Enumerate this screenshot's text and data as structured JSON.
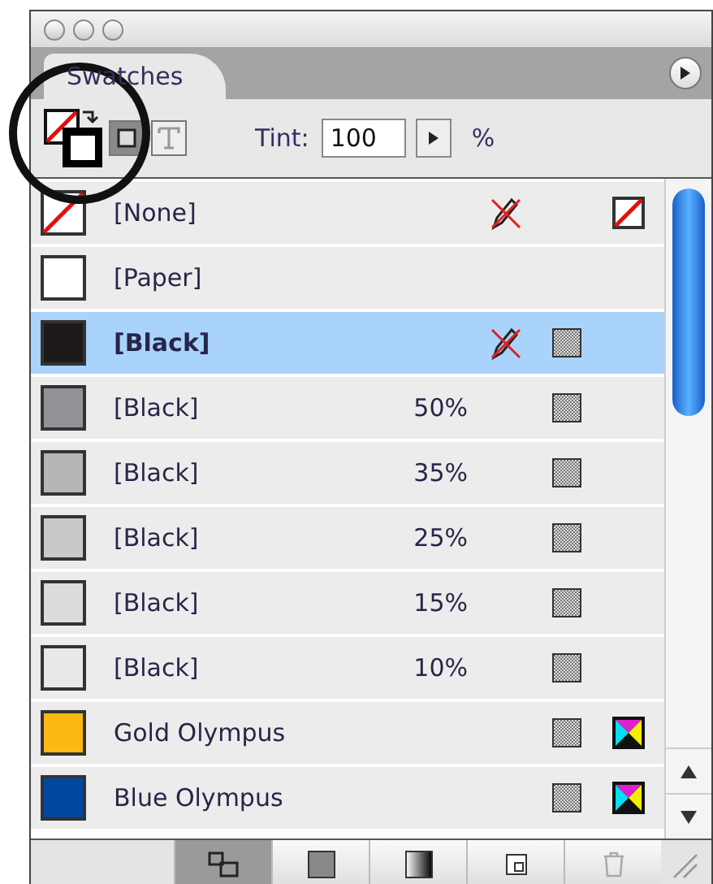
{
  "panel": {
    "tab": "Swatches"
  },
  "toolbar": {
    "modes": [
      {
        "kind": "container",
        "selected": true
      },
      {
        "kind": "text",
        "selected": false
      }
    ],
    "tint_label": "Tint:",
    "tint_value": "100",
    "percent": "%"
  },
  "swatches": [
    {
      "name": "[None]",
      "kind": "none",
      "locked": true,
      "process": false,
      "cmyk": false,
      "selected": false
    },
    {
      "name": "[Paper]",
      "kind": "solid",
      "color": "#ffffff",
      "locked": false,
      "process": false,
      "cmyk": false,
      "selected": false
    },
    {
      "name": "[Black]",
      "kind": "solid",
      "color": "#1e1a1a",
      "locked": true,
      "process": true,
      "cmyk": false,
      "selected": true
    },
    {
      "name": "[Black]",
      "kind": "solid",
      "color": "#929396",
      "tint": "50%",
      "locked": false,
      "process": true,
      "cmyk": false,
      "selected": false
    },
    {
      "name": "[Black]",
      "kind": "solid",
      "color": "#b5b6b8",
      "tint": "35%",
      "locked": false,
      "process": true,
      "cmyk": false,
      "selected": false
    },
    {
      "name": "[Black]",
      "kind": "solid",
      "color": "#c8c9cb",
      "tint": "25%",
      "locked": false,
      "process": true,
      "cmyk": false,
      "selected": false
    },
    {
      "name": "[Black]",
      "kind": "solid",
      "color": "#dcdcde",
      "tint": "15%",
      "locked": false,
      "process": true,
      "cmyk": false,
      "selected": false
    },
    {
      "name": "[Black]",
      "kind": "solid",
      "color": "#e8e8ea",
      "tint": "10%",
      "locked": false,
      "process": true,
      "cmyk": false,
      "selected": false
    },
    {
      "name": "Gold Olympus",
      "kind": "solid",
      "color": "#fdb813",
      "locked": false,
      "process": true,
      "cmyk": true,
      "selected": false
    },
    {
      "name": "Blue Olympus",
      "kind": "solid",
      "color": "#0047a0",
      "locked": false,
      "process": true,
      "cmyk": true,
      "selected": false
    }
  ]
}
